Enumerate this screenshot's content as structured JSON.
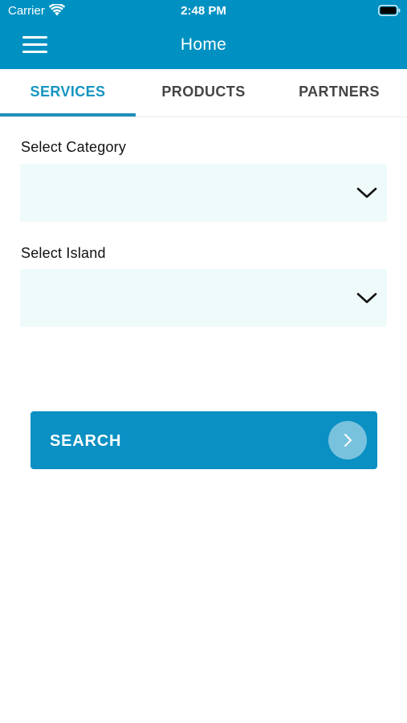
{
  "status_bar": {
    "carrier": "Carrier",
    "time": "2:48 PM",
    "wifi_icon": "wifi-icon",
    "battery_icon": "battery-icon"
  },
  "nav_bar": {
    "title": "Home",
    "menu_icon": "hamburger-menu-icon",
    "background_color": "#0091c2"
  },
  "tabs": [
    {
      "label": "SERVICES",
      "active": true
    },
    {
      "label": "PRODUCTS",
      "active": false
    },
    {
      "label": "PARTNERS",
      "active": false
    }
  ],
  "form": {
    "category": {
      "label": "Select Category",
      "value": ""
    },
    "island": {
      "label": "Select Island",
      "value": ""
    }
  },
  "search_button": {
    "label": "SEARCH",
    "icon": "chevron-right-icon"
  },
  "colors": {
    "accent": "#1595c1",
    "select_background": "#effbfa",
    "button": "#0a90c3"
  }
}
